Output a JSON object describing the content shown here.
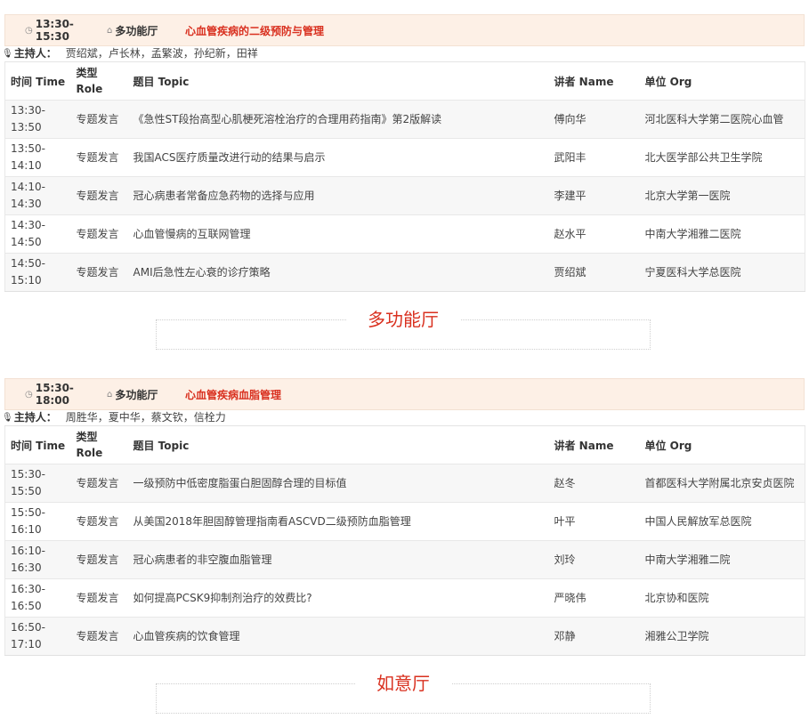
{
  "table_headers": {
    "time": "时间 Time",
    "role": "类型 Role",
    "topic": "题目 Topic",
    "speaker": "讲者 Name",
    "org": "单位 Org"
  },
  "chairs_label": "主持人：",
  "sessions": [
    {
      "time": "13:30-15:30",
      "hall": "多功能厅",
      "title": "心血管疾病的二级预防与管理",
      "chairs": "贾绍斌，卢长林，孟繁波，孙纪新，田祥",
      "rows": [
        {
          "time_start": "13:30-",
          "time_end": "13:50",
          "role": "专题发言",
          "topic": "《急性ST段抬高型心肌梗死溶栓治疗的合理用药指南》第2版解读",
          "speaker": "傅向华",
          "org": "河北医科大学第二医院心血管"
        },
        {
          "time_start": "13:50-",
          "time_end": "14:10",
          "role": "专题发言",
          "topic": "我国ACS医疗质量改进行动的结果与启示",
          "speaker": "武阳丰",
          "org": "北大医学部公共卫生学院"
        },
        {
          "time_start": "14:10-",
          "time_end": "14:30",
          "role": "专题发言",
          "topic": "冠心病患者常备应急药物的选择与应用",
          "speaker": "李建平",
          "org": "北京大学第一医院"
        },
        {
          "time_start": "14:30-",
          "time_end": "14:50",
          "role": "专题发言",
          "topic": "心血管慢病的互联网管理",
          "speaker": "赵水平",
          "org": "中南大学湘雅二医院"
        },
        {
          "time_start": "14:50-",
          "time_end": "15:10",
          "role": "专题发言",
          "topic": "AMI后急性左心衰的诊疗策略",
          "speaker": "贾绍斌",
          "org": "宁夏医科大学总医院"
        }
      ]
    },
    {
      "time": "15:30-18:00",
      "hall": "多功能厅",
      "title": "心血管疾病血脂管理",
      "chairs": "周胜华，夏中华，蔡文钦，信栓力",
      "rows": [
        {
          "time_start": "15:30-",
          "time_end": "15:50",
          "role": "专题发言",
          "topic": "一级预防中低密度脂蛋白胆固醇合理的目标值",
          "speaker": "赵冬",
          "org": "首都医科大学附属北京安贞医院"
        },
        {
          "time_start": "15:50-",
          "time_end": "16:10",
          "role": "专题发言",
          "topic": "从美国2018年胆固醇管理指南看ASCVD二级预防血脂管理",
          "speaker": "叶平",
          "org": "中国人民解放军总医院"
        },
        {
          "time_start": "16:10-",
          "time_end": "16:30",
          "role": "专题发言",
          "topic": "冠心病患者的非空腹血脂管理",
          "speaker": "刘玲",
          "org": "中南大学湘雅二院"
        },
        {
          "time_start": "16:30-",
          "time_end": "16:50",
          "role": "专题发言",
          "topic": "如何提高PCSK9抑制剂治疗的效费比?",
          "speaker": "严晓伟",
          "org": "北京协和医院"
        },
        {
          "time_start": "16:50-",
          "time_end": "17:10",
          "role": "专题发言",
          "topic": "心血管疾病的饮食管理",
          "speaker": "邓静",
          "org": "湘雅公卫学院"
        }
      ]
    }
  ],
  "hall_dividers": [
    "多功能厅",
    "如意厅"
  ],
  "colors": {
    "accent_red": "#d9301f",
    "header_bg": "#fdf0e6",
    "row_alt_bg": "#f7f7f7"
  },
  "icons": {
    "time": "clock-icon",
    "hall": "home-icon",
    "chairs": "microphone-icon"
  }
}
